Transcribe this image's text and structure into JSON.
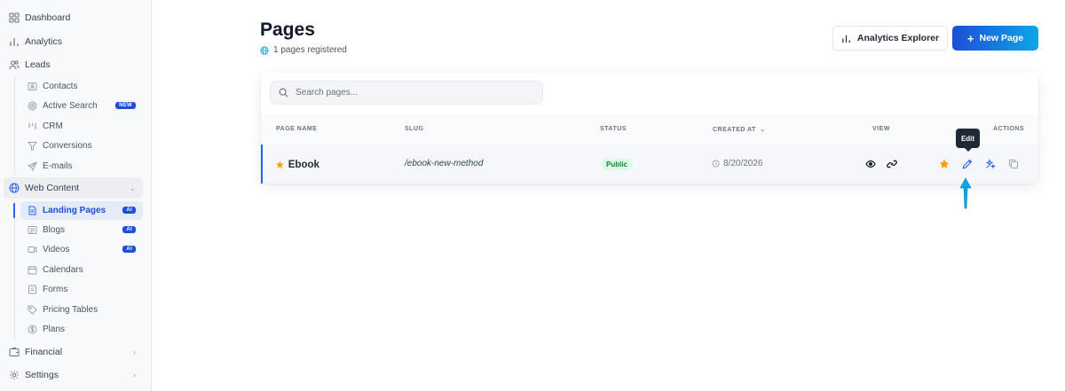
{
  "sidebar": {
    "items": [
      {
        "label": "Dashboard",
        "icon": "grid-icon"
      },
      {
        "label": "Analytics",
        "icon": "bar-chart-icon"
      },
      {
        "label": "Leads",
        "icon": "users-icon"
      }
    ],
    "leads_sub": [
      {
        "label": "Contacts",
        "icon": "contact-card-icon"
      },
      {
        "label": "Active Search",
        "icon": "radar-icon",
        "badge": "NEW"
      },
      {
        "label": "CRM",
        "icon": "kanban-icon"
      },
      {
        "label": "Conversions",
        "icon": "funnel-icon"
      },
      {
        "label": "E-mails",
        "icon": "send-icon"
      }
    ],
    "web_content": {
      "label": "Web Content",
      "icon": "globe-icon"
    },
    "web_sub": [
      {
        "label": "Landing Pages",
        "icon": "file-icon",
        "badge": "AI",
        "active": true
      },
      {
        "label": "Blogs",
        "icon": "newspaper-icon",
        "badge": "AI"
      },
      {
        "label": "Videos",
        "icon": "video-icon",
        "badge": "AI"
      },
      {
        "label": "Calendars",
        "icon": "calendar-icon"
      },
      {
        "label": "Forms",
        "icon": "form-icon"
      },
      {
        "label": "Pricing Tables",
        "icon": "tag-icon"
      },
      {
        "label": "Plans",
        "icon": "dollar-icon"
      }
    ],
    "financial": {
      "label": "Financial",
      "icon": "wallet-icon"
    },
    "settings": {
      "label": "Settings",
      "icon": "gear-icon"
    }
  },
  "header": {
    "title": "Pages",
    "subtitle": "1 pages registered",
    "analytics_button": "Analytics Explorer",
    "new_page_button": "New Page",
    "new_page_plus": "+"
  },
  "search": {
    "placeholder": "Search pages..."
  },
  "table": {
    "columns": {
      "name": "PAGE NAME",
      "slug": "SLUG",
      "status": "STATUS",
      "created": "CREATED AT",
      "view": "VIEW",
      "actions": "ACTIONS"
    },
    "rows": [
      {
        "name": "Ebook",
        "slug": "/ebook-new-method",
        "status": "Public",
        "created": "8/20/2026"
      }
    ]
  },
  "tooltip": {
    "text": "Edit"
  },
  "colors": {
    "accent": "#2563eb",
    "star": "#f59e0b",
    "status_bg": "#dcfce7",
    "status_fg": "#15803d",
    "arrow": "#0ea5e9"
  }
}
